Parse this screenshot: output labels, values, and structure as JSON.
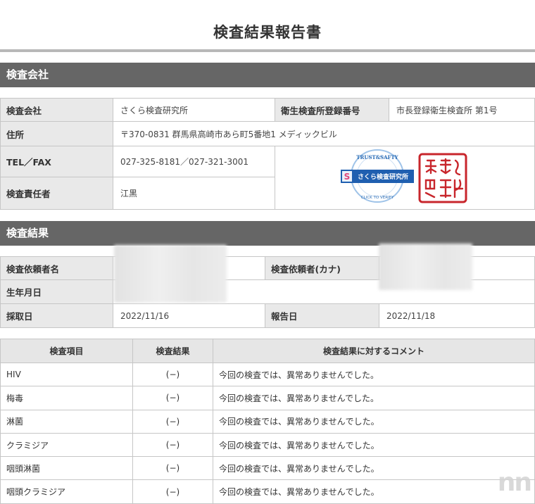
{
  "title": "検査結果報告書",
  "company_section": {
    "header": "検査会社",
    "company_label": "検査会社",
    "company_value": "さくら検査研究所",
    "reg_label": "衛生検査所登録番号",
    "reg_value": "市長登録衛生検査所 第1号",
    "address_label": "住所",
    "address_value": "〒370-0831 群馬県高崎市あら町5番地1 メディックビル",
    "tel_label": "TEL／FAX",
    "tel_value": "027-325-8181／027-321-3001",
    "manager_label": "検査責任者",
    "manager_value": "江黒",
    "badge_text": "さくら検査研究所",
    "badge_ring_top": "TRUST&SAFTY",
    "badge_ring_bottom": "CLICK TO VERIFY",
    "seal_text": "さくら検査研究所之印"
  },
  "result_section": {
    "header": "検査結果",
    "requester_label": "検査依頼者名",
    "requester_kana_label": "検査依頼者(カナ)",
    "birth_label": "生年月日",
    "collect_label": "採取日",
    "collect_value": "2022/11/16",
    "report_label": "報告日",
    "report_value": "2022/11/18"
  },
  "results_table": {
    "headers": [
      "検査項目",
      "検査結果",
      "検査結果に対するコメント"
    ],
    "rows": [
      {
        "item": "HIV",
        "result": "(−)",
        "comment": "今回の検査では、異常ありませんでした。"
      },
      {
        "item": "梅毒",
        "result": "(−)",
        "comment": "今回の検査では、異常ありませんでした。"
      },
      {
        "item": "淋菌",
        "result": "(−)",
        "comment": "今回の検査では、異常ありませんでした。"
      },
      {
        "item": "クラミジア",
        "result": "(−)",
        "comment": "今回の検査では、異常ありませんでした。"
      },
      {
        "item": "咽頭淋菌",
        "result": "(−)",
        "comment": "今回の検査では、異常ありませんでした。"
      },
      {
        "item": "咽頭クラミジア",
        "result": "(−)",
        "comment": "今回の検査では、異常ありませんでした。"
      }
    ]
  },
  "watermark": "nn",
  "colors": {
    "section_bar": "#666666",
    "label_bg": "#e9e9e9",
    "badge_blue": "#1f5fb0",
    "seal_red": "#c8262c"
  }
}
